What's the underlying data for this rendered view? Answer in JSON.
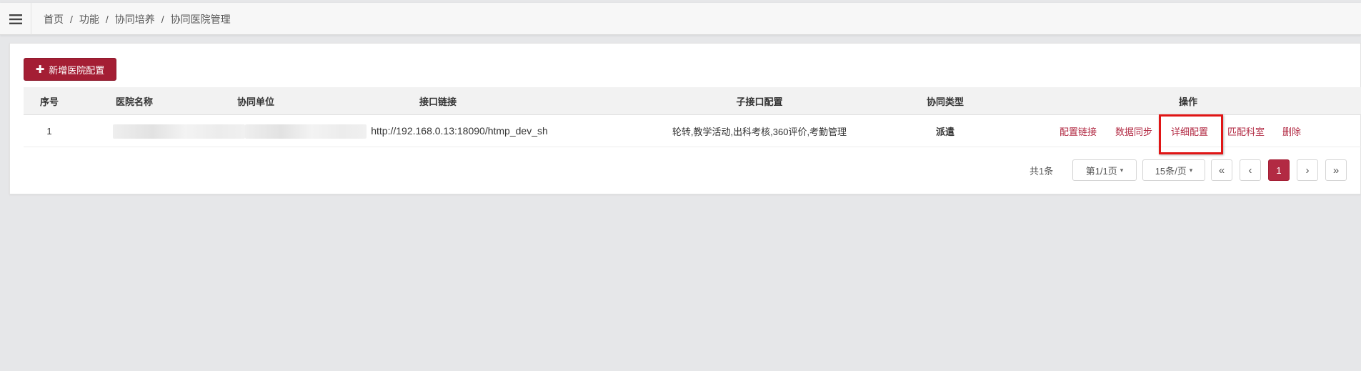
{
  "header": {
    "menu_icon": "hamburger-icon",
    "breadcrumb": [
      "首页",
      "功能",
      "协同培养",
      "协同医院管理"
    ],
    "separator": "/"
  },
  "toolbar": {
    "add_label": "新增医院配置",
    "add_icon": "plus-icon"
  },
  "table": {
    "columns": [
      "序号",
      "医院名称",
      "协同单位",
      "接口链接",
      "子接口配置",
      "协同类型",
      "操作"
    ],
    "rows": [
      {
        "index": "1",
        "hospital_name": "",
        "partner_unit": "",
        "url": "http://192.168.0.13:18090/htmp_dev_sh",
        "sub_config": "轮转,教学活动,出科考核,360评价,考勤管理",
        "type": "派遣",
        "actions": [
          "配置链接",
          "数据同步",
          "详细配置",
          "匹配科室",
          "删除"
        ]
      }
    ]
  },
  "pagination": {
    "total": "共1条",
    "page_select": "第1/1页",
    "size_select": "15条/页",
    "first": "«",
    "prev": "‹",
    "current": "1",
    "next": "›",
    "last": "»"
  },
  "colors": {
    "primary": "#a41e34",
    "link": "#b22a43",
    "highlight": "#e01515",
    "background": "#e6e7e9"
  }
}
